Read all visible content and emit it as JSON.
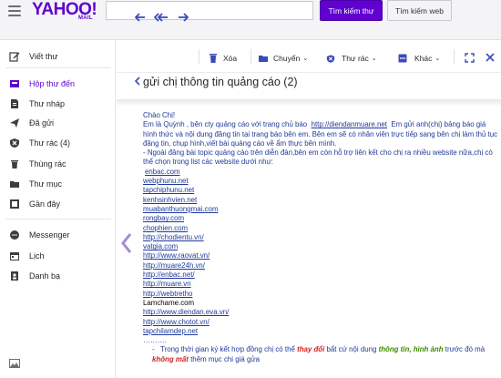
{
  "header": {
    "logo": "YAHOO!",
    "logo_sub": "MAIL",
    "search_value": "",
    "search_mail_label": "Tìm kiếm thư",
    "search_web_label": "Tìm kiếm web"
  },
  "sidebar": {
    "compose": "Viết thư",
    "items": [
      {
        "label": "Hộp thư đến",
        "icon": "inbox-icon"
      },
      {
        "label": "Thư nháp",
        "icon": "drafts-icon"
      },
      {
        "label": "Đã gửi",
        "icon": "sent-icon"
      },
      {
        "label": "Thư rác (4)",
        "icon": "spam-icon"
      },
      {
        "label": "Thùng rác",
        "icon": "trash-icon"
      },
      {
        "label": "Thư mục",
        "icon": "folder-icon"
      },
      {
        "label": "Gần đây",
        "icon": "recent-icon"
      }
    ],
    "apps": [
      {
        "label": "Messenger",
        "icon": "messenger-icon"
      },
      {
        "label": "Lịch",
        "icon": "calendar-icon"
      },
      {
        "label": "Danh bạ",
        "icon": "contacts-icon"
      }
    ],
    "accent": "#5f01d1"
  },
  "toolbar": {
    "delete": "Xóa",
    "move": "Chuyển",
    "spam": "Thư rác",
    "more": "Khác"
  },
  "message": {
    "subject": "gửi chị thông tin quảng cáo (2)",
    "greeting": "Chào Chị!",
    "intro_1": "Em là Quỳnh , bên cty quảng cáo với trang chủ báo",
    "intro_link": "http://diendanmuare.net",
    "intro_2": "Em gửi anh(chị) bảng báo giá hình thức và nội dung đăng tin tại trang báo bên em. Bên em sẽ có nhân viên trực tiếp sang bên chị làm thủ tục đăng tin, chụp hình,viết bài quảng cáo về ẩm thực bên mình.",
    "intro_3": "- Ngoài đăng bài topic quảng cáo trên diễn đàn,bên em còn hỗ trợ liên kết cho chị ra nhiều website nữa,chị có thể chọn trong list các website dưới như:",
    "links": [
      "enbac.com",
      "webphunu.net",
      "tapchiphunu.net",
      "kenhsinhvien.net",
      "muabanthuongmai.com",
      "rongbay.com",
      "chophien.com",
      "http://chodientu.vn/",
      "vatgia.com",
      "http://www.raovat.vn/",
      "http://muare24h.vn/",
      "http://enbac.net/",
      "http://muare.vn",
      "http://webtretho"
    ],
    "plain_item": "Lamchame.com",
    "links_2": [
      "http://www.diendan.eva.vn/",
      "http://www.chotot.vn/",
      "tapchilamdep.net"
    ],
    "dots": "……….",
    "footer_1": "Trong thời gian ký kết hợp đồng  chị có thể",
    "footer_red": "thay đổi",
    "footer_2": "bất cứ nội dung",
    "footer_green": "thông tin, hình ảnh",
    "footer_3": "trước đó mà",
    "footer_red_2": "không mất",
    "footer_4": "thêm mục chi giá gửa"
  }
}
